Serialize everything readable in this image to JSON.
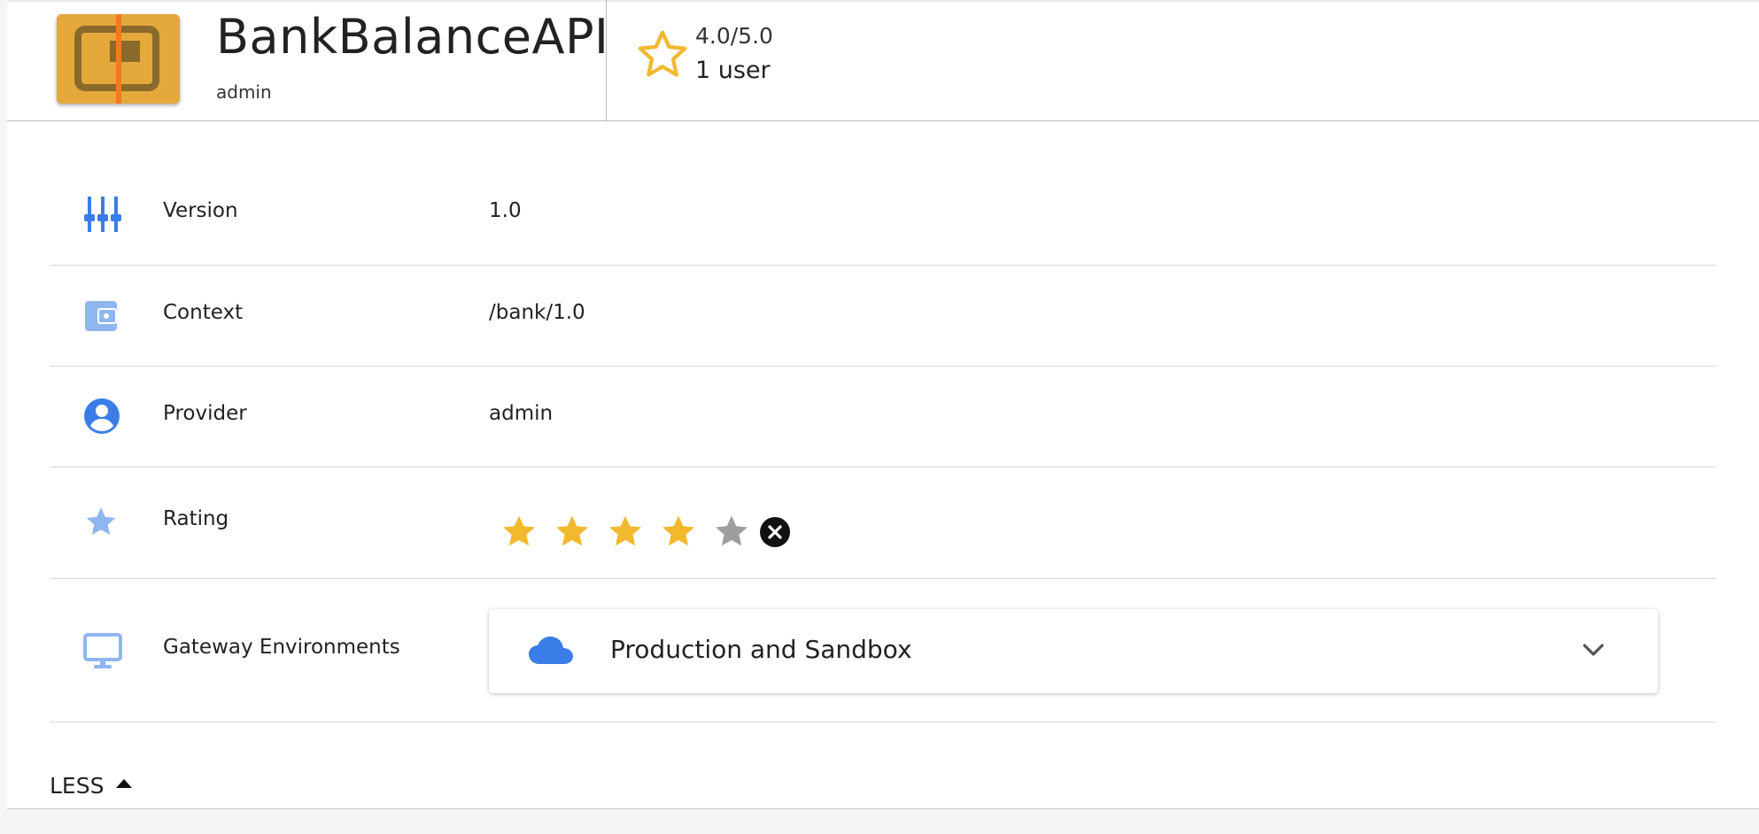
{
  "header": {
    "api_name": "BankBalanceAPI",
    "owner": "admin",
    "rating_text": "4.0/5.0",
    "users_text": "1 user"
  },
  "details": {
    "version": {
      "label": "Version",
      "value": "1.0",
      "icon": "tuning-sliders-icon"
    },
    "context": {
      "label": "Context",
      "value": "/bank/1.0",
      "icon": "wallet-icon"
    },
    "provider": {
      "label": "Provider",
      "value": "admin",
      "icon": "account-circle-icon"
    },
    "rating": {
      "label": "Rating",
      "value": 4,
      "max": 5,
      "icon": "star-icon"
    },
    "gateway": {
      "label": "Gateway Environments",
      "selected": "Production and Sandbox",
      "icon": "monitor-icon"
    }
  },
  "less_label": "LESS",
  "colors": {
    "accent_blue": "#3b7de8",
    "light_blue": "#8fb6ef",
    "star_gold": "#f2b92f",
    "star_empty": "#9e9e9e",
    "thumb_bg": "#e4a93a"
  }
}
